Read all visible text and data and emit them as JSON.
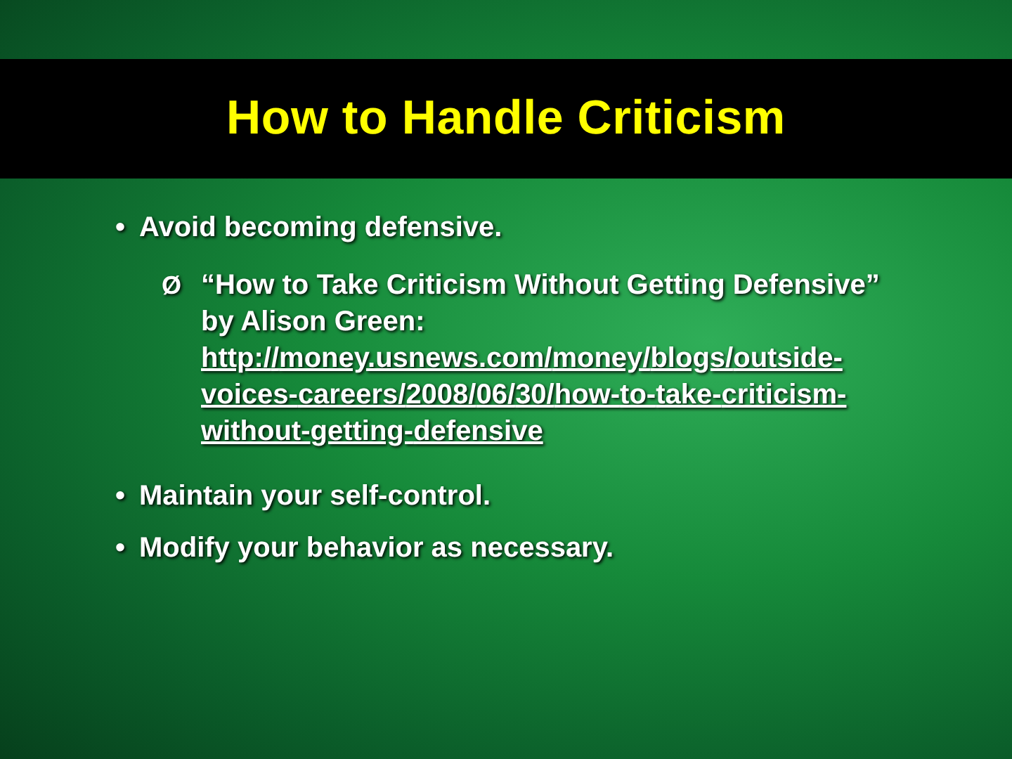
{
  "title": "How to Handle Criticism",
  "bullets": [
    {
      "marker": "•",
      "text": "Avoid becoming defensive.",
      "children": [
        {
          "marker": "Ø",
          "text": "“How to Take Criticism Without Getting Defensive” by Alison Green:",
          "link": "http://money.usnews.com/money/blogs/outside-voices-careers/2008/06/30/how-to-take-criticism-without-getting-defensive"
        }
      ]
    },
    {
      "marker": "•",
      "text": "Maintain your self-control."
    },
    {
      "marker": "•",
      "text": "Modify your behavior as necessary."
    }
  ]
}
